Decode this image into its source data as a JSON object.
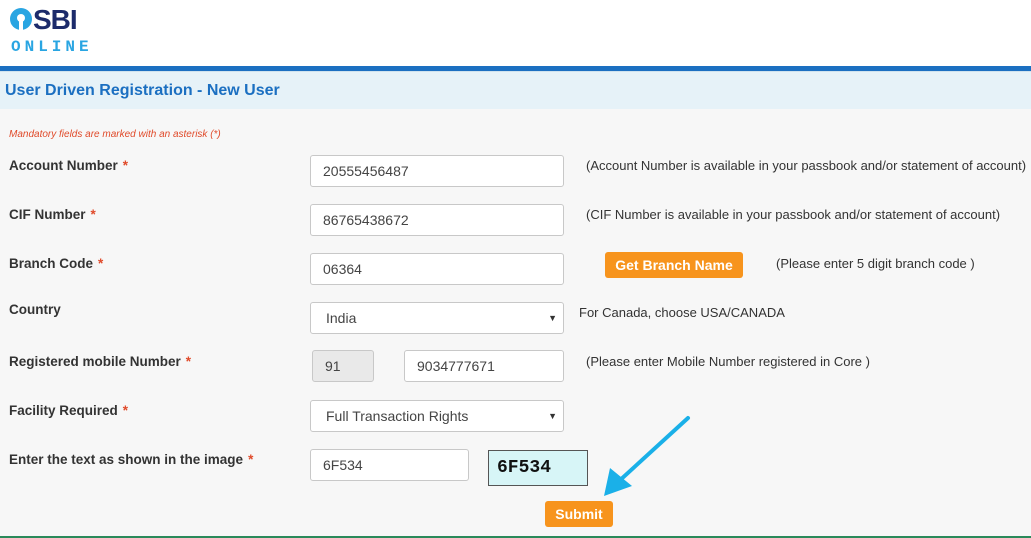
{
  "header": {
    "logo_sbi": "SBI",
    "logo_online": "ONLINE"
  },
  "page": {
    "title": "User Driven Registration - New User",
    "mandatory_note": "Mandatory fields are marked with an asterisk (*)"
  },
  "form": {
    "account_number": {
      "label": "Account Number",
      "value": "20555456487",
      "hint": "(Account Number is available in your passbook and/or statement of account)"
    },
    "cif_number": {
      "label": "CIF Number",
      "value": "86765438672",
      "hint": "(CIF Number is available in your passbook and/or statement of account)"
    },
    "branch_code": {
      "label": "Branch Code",
      "value": "06364",
      "button": "Get Branch Name",
      "hint": "(Please enter 5 digit branch code )"
    },
    "country": {
      "label": "Country",
      "value": "India",
      "hint": "For Canada, choose USA/CANADA"
    },
    "mobile": {
      "label": "Registered mobile Number",
      "country_code": "91",
      "value": "9034777671",
      "hint": "(Please enter Mobile Number registered in Core )"
    },
    "facility": {
      "label": "Facility Required",
      "value": "Full Transaction Rights"
    },
    "captcha": {
      "label": "Enter the text as shown in the image",
      "value": "6F534",
      "image_text": "6F534"
    },
    "submit_label": "Submit",
    "asterisk": "*"
  },
  "colors": {
    "brand_blue": "#1b6fc1",
    "accent_orange": "#f7941d",
    "asterisk_red": "#e04a2a",
    "arrow_cyan": "#1ab0e8"
  }
}
